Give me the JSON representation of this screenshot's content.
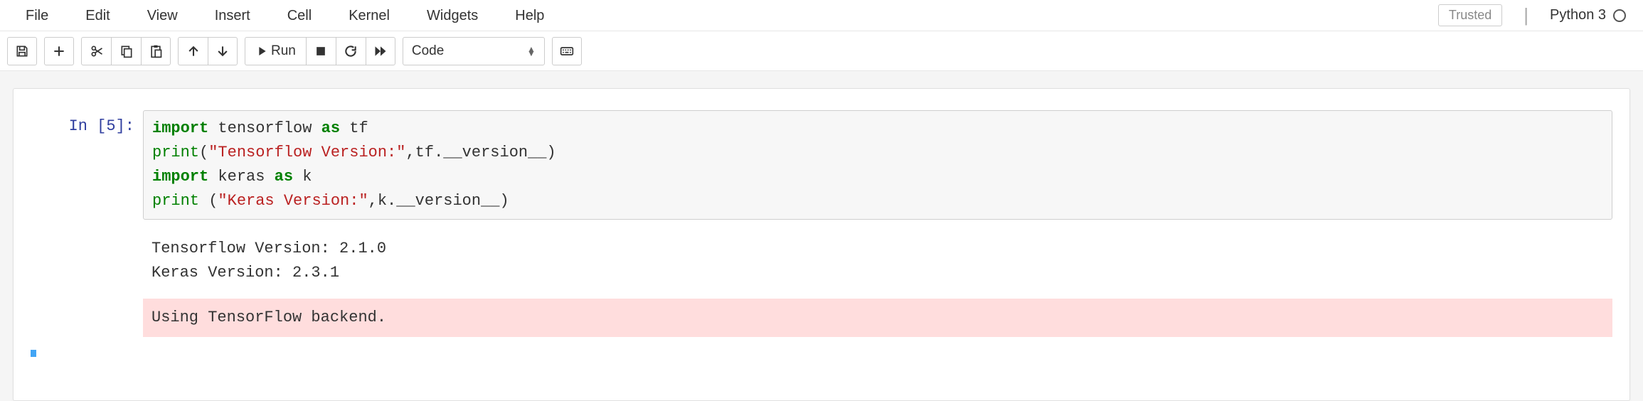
{
  "menubar": {
    "items": [
      "File",
      "Edit",
      "View",
      "Insert",
      "Cell",
      "Kernel",
      "Widgets",
      "Help"
    ],
    "trusted_label": "Trusted",
    "kernel_name": "Python 3"
  },
  "toolbar": {
    "save_title": "Save and Checkpoint",
    "insert_title": "Insert cell below",
    "cut_title": "Cut",
    "copy_title": "Copy",
    "paste_title": "Paste",
    "up_title": "Move up",
    "down_title": "Move down",
    "run_label": "Run",
    "interrupt_title": "Interrupt",
    "restart_title": "Restart kernel",
    "restart_run_title": "Restart and run all",
    "celltype_value": "Code",
    "cmd_palette_title": "Command palette"
  },
  "cell": {
    "prompt_prefix": "In [",
    "exec_count": "5",
    "prompt_suffix": "]:",
    "code_tokens": [
      [
        [
          "kw",
          "import"
        ],
        [
          "txt",
          " tensorflow "
        ],
        [
          "kw",
          "as"
        ],
        [
          "txt",
          " tf"
        ]
      ],
      [
        [
          "func",
          "print"
        ],
        [
          "txt",
          "("
        ],
        [
          "str",
          "\"Tensorflow Version:\""
        ],
        [
          "txt",
          ",tf.__version__)"
        ]
      ],
      [
        [
          "kw",
          "import"
        ],
        [
          "txt",
          " keras "
        ],
        [
          "kw",
          "as"
        ],
        [
          "txt",
          " k"
        ]
      ],
      [
        [
          "func",
          "print"
        ],
        [
          "txt",
          " ("
        ],
        [
          "str",
          "\"Keras Version:\""
        ],
        [
          "txt",
          ",k.__version__)"
        ]
      ]
    ],
    "stdout": "Tensorflow Version: 2.1.0\nKeras Version: 2.3.1",
    "stderr": "Using TensorFlow backend."
  }
}
